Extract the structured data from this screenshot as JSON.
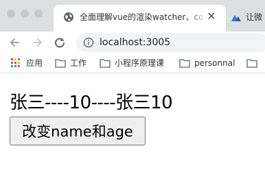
{
  "browser": {
    "tabs": [
      {
        "title": "全面理解vue的渲染watcher、computed和user watcher",
        "icon": "globe-icon",
        "active": true
      },
      {
        "title": "让微",
        "icon": "nuxt-logo-icon",
        "active": false
      }
    ],
    "close_glyph": "✕",
    "address": "localhost:3005",
    "bookmarks": [
      {
        "label": "应用",
        "icon": "apps-grid-icon"
      },
      {
        "label": "工作",
        "icon": "folder-icon"
      },
      {
        "label": "小程序原理课",
        "icon": "folder-icon"
      },
      {
        "label": "personnal",
        "icon": "folder-icon"
      }
    ]
  },
  "page": {
    "output_text": "张三----10----张三10",
    "button_label": "改变name和age"
  }
}
